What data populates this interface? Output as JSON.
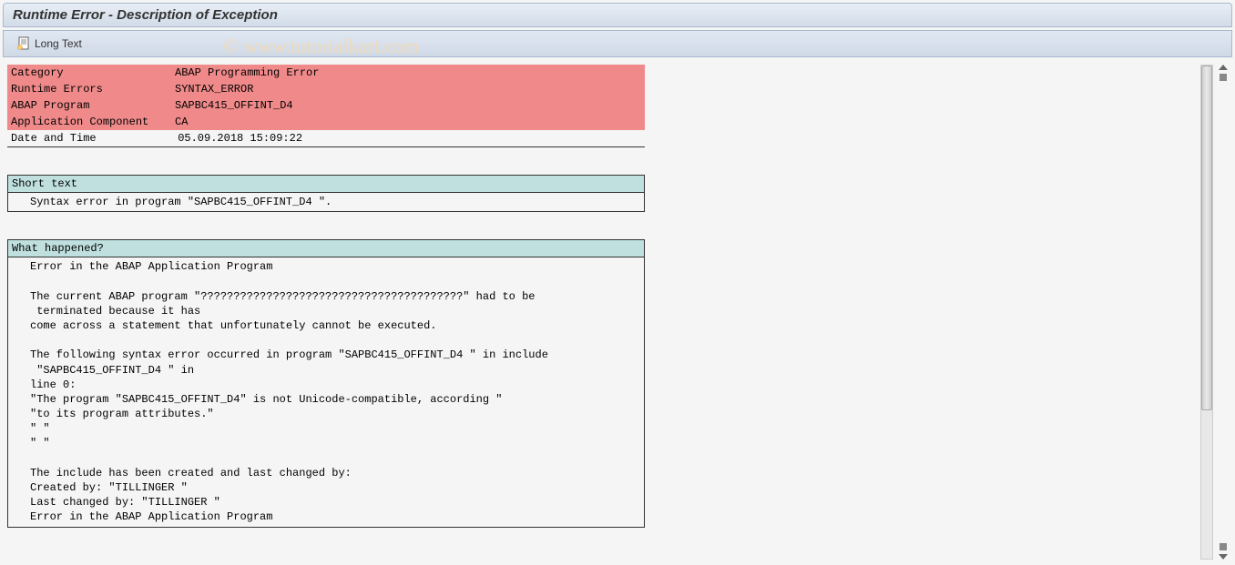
{
  "title": "Runtime Error - Description of Exception",
  "toolbar": {
    "longTextLabel": "Long Text"
  },
  "watermark": "© www.tutorialkart.com",
  "errorInfo": {
    "rows": [
      {
        "label": "Category",
        "value": "ABAP Programming Error"
      },
      {
        "label": "Runtime Errors",
        "value": "SYNTAX_ERROR"
      },
      {
        "label": "ABAP Program",
        "value": "SAPBC415_OFFINT_D4"
      },
      {
        "label": "Application Component",
        "value": "CA"
      }
    ],
    "dateLabel": "Date and Time",
    "dateValue": "05.09.2018 15:09:22"
  },
  "shortText": {
    "header": "Short text",
    "body": "Syntax error in program \"SAPBC415_OFFINT_D4 \"."
  },
  "whatHappened": {
    "header": "What happened?",
    "lines": [
      "Error in the ABAP Application Program",
      "",
      "The current ABAP program \"????????????????????????????????????????\" had to be",
      " terminated because it has",
      "come across a statement that unfortunately cannot be executed.",
      "",
      "The following syntax error occurred in program \"SAPBC415_OFFINT_D4 \" in include",
      " \"SAPBC415_OFFINT_D4 \" in",
      "line 0:",
      "\"The program \"SAPBC415_OFFINT_D4\" is not Unicode-compatible, according \"",
      "\"to its program attributes.\"",
      "\" \"",
      "\" \"",
      "",
      "The include has been created and last changed by:",
      "Created by: \"TILLINGER \"",
      "Last changed by: \"TILLINGER \"",
      "Error in the ABAP Application Program"
    ]
  }
}
